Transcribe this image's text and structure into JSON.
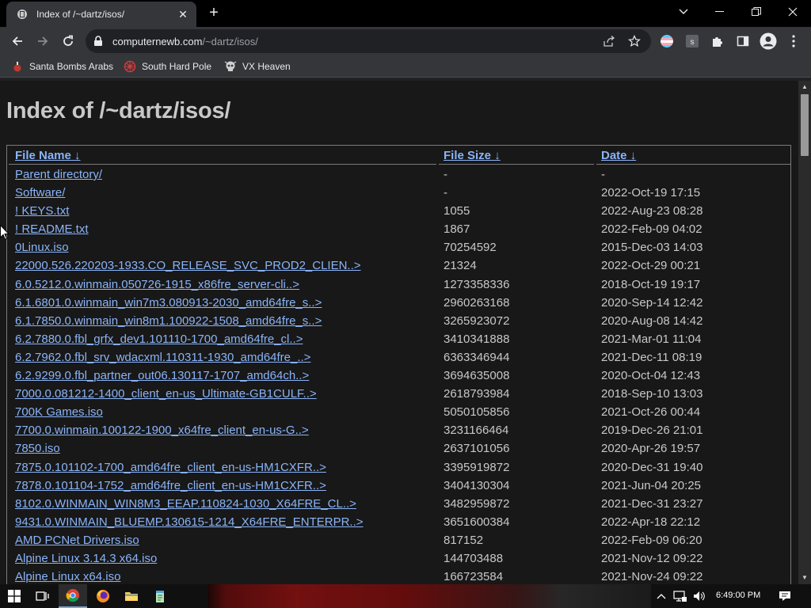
{
  "browser": {
    "tab_title": "Index of /~dartz/isos/",
    "url_host": "computernewb.com",
    "url_path": "/~dartz/isos/",
    "bookmarks": [
      {
        "label": "Santa Bombs Arabs",
        "icon": "bomb-icon"
      },
      {
        "label": "South Hard Pole",
        "icon": "flower-icon"
      },
      {
        "label": "VX Heaven",
        "icon": "skull-icon"
      }
    ]
  },
  "page": {
    "title": "Index of /~dartz/isos/",
    "columns": {
      "name": "File Name",
      "size": "File Size",
      "date": "Date",
      "sort_arrow": "↓"
    },
    "rows": [
      {
        "name": "Parent directory/",
        "size": "-",
        "date": "-"
      },
      {
        "name": "Software/",
        "size": "-",
        "date": "2022-Oct-19 17:15"
      },
      {
        "name": "! KEYS.txt",
        "size": "1055",
        "date": "2022-Aug-23 08:28"
      },
      {
        "name": "! README.txt",
        "size": "1867",
        "date": "2022-Feb-09 04:02"
      },
      {
        "name": "0Linux.iso",
        "size": "70254592",
        "date": "2015-Dec-03 14:03"
      },
      {
        "name": "22000.526.220203-1933.CO_RELEASE_SVC_PROD2_CLIEN..>",
        "size": "21324",
        "date": "2022-Oct-29 00:21"
      },
      {
        "name": "6.0.5212.0.winmain.050726-1915_x86fre_server-cli..>",
        "size": "1273358336",
        "date": "2018-Oct-19 19:17"
      },
      {
        "name": "6.1.6801.0.winmain_win7m3.080913-2030_amd64fre_s..>",
        "size": "2960263168",
        "date": "2020-Sep-14 12:42"
      },
      {
        "name": "6.1.7850.0.winmain_win8m1.100922-1508_amd64fre_s..>",
        "size": "3265923072",
        "date": "2020-Aug-08 14:42"
      },
      {
        "name": "6.2.7880.0.fbl_grfx_dev1.101110-1700_amd64fre_cl..>",
        "size": "3410341888",
        "date": "2021-Mar-01 11:04"
      },
      {
        "name": "6.2.7962.0.fbl_srv_wdacxml.110311-1930_amd64fre_..>",
        "size": "6363346944",
        "date": "2021-Dec-11 08:19"
      },
      {
        "name": "6.2.9299.0.fbl_partner_out06.130117-1707_amd64ch..>",
        "size": "3694635008",
        "date": "2020-Oct-04 12:43"
      },
      {
        "name": "7000.0.081212-1400_client_en-us_Ultimate-GB1CULF..>",
        "size": "2618793984",
        "date": "2018-Sep-10 13:03"
      },
      {
        "name": "700K Games.iso",
        "size": "5050105856",
        "date": "2021-Oct-26 00:44"
      },
      {
        "name": "7700.0.winmain.100122-1900_x64fre_client_en-us-G..>",
        "size": "3231166464",
        "date": "2019-Dec-26 21:01"
      },
      {
        "name": "7850.iso",
        "size": "2637101056",
        "date": "2020-Apr-26 19:57"
      },
      {
        "name": "7875.0.101102-1700_amd64fre_client_en-us-HM1CXFR..>",
        "size": "3395919872",
        "date": "2020-Dec-31 19:40"
      },
      {
        "name": "7878.0.101104-1752_amd64fre_client_en-us-HM1CXFR..>",
        "size": "3404130304",
        "date": "2021-Jun-04 20:25"
      },
      {
        "name": "8102.0.WINMAIN_WIN8M3_EEAP.110824-1030_X64FRE_CL..>",
        "size": "3482959872",
        "date": "2021-Dec-31 23:27"
      },
      {
        "name": "9431.0.WINMAIN_BLUEMP.130615-1214_X64FRE_ENTERPR..>",
        "size": "3651600384",
        "date": "2022-Apr-18 22:12"
      },
      {
        "name": "AMD PCNet Drivers.iso",
        "size": "817152",
        "date": "2022-Feb-09 06:20"
      },
      {
        "name": "Alpine Linux 3.14.3 x64.iso",
        "size": "144703488",
        "date": "2021-Nov-12 09:22"
      },
      {
        "name": "Alpine Linux x64.iso",
        "size": "166723584",
        "date": "2021-Nov-24 09:22"
      }
    ]
  },
  "taskbar": {
    "clock": "6:49:00 PM"
  },
  "colors": {
    "link": "#8ab4f8",
    "text": "#c8c8c8",
    "page_bg": "#181818"
  }
}
